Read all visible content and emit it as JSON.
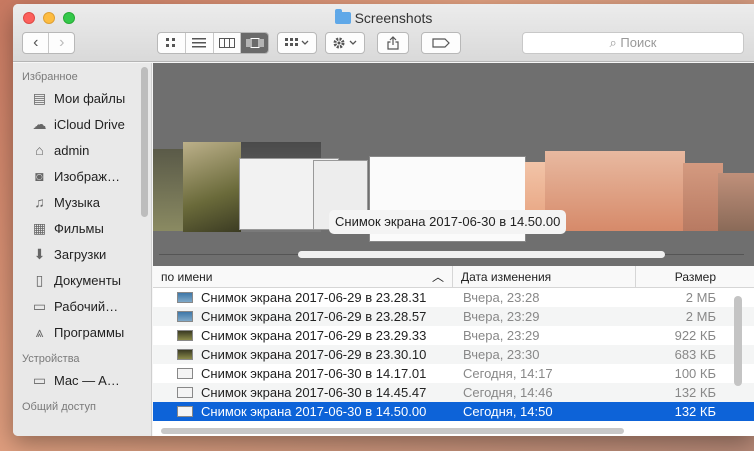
{
  "window": {
    "title": "Screenshots"
  },
  "toolbar": {
    "back_label": "‹",
    "forward_label": "›",
    "view_icons": [
      "icon-view-icon",
      "list-view-icon",
      "column-view-icon",
      "coverflow-view-icon"
    ],
    "search_placeholder": "⌕ Поиск"
  },
  "sidebar": {
    "sections": [
      {
        "title": "Избранное",
        "items": [
          {
            "label": "Мои файлы",
            "icon": "all-files-icon"
          },
          {
            "label": "iCloud Drive",
            "icon": "cloud-icon"
          },
          {
            "label": "admin",
            "icon": "home-icon"
          },
          {
            "label": "Изображ…",
            "icon": "camera-icon"
          },
          {
            "label": "Музыка",
            "icon": "music-icon"
          },
          {
            "label": "Фильмы",
            "icon": "film-icon"
          },
          {
            "label": "Загрузки",
            "icon": "download-icon"
          },
          {
            "label": "Документы",
            "icon": "document-icon"
          },
          {
            "label": "Рабочий…",
            "icon": "desktop-icon"
          },
          {
            "label": "Программы",
            "icon": "apps-icon"
          }
        ]
      },
      {
        "title": "Устройства",
        "items": [
          {
            "label": "Mac — A…",
            "icon": "computer-icon"
          }
        ]
      },
      {
        "title": "Общий доступ",
        "items": []
      }
    ]
  },
  "coverflow": {
    "selected_label": "Снимок экрана 2017-06-30 в 14.50.00"
  },
  "list": {
    "columns": {
      "name": "по имени",
      "date": "Дата изменения",
      "size": "Размер"
    },
    "rows": [
      {
        "name": "Снимок экрана 2017-06-29 в 23.28.31",
        "date": "Вчера, 23:28",
        "size": "2 МБ"
      },
      {
        "name": "Снимок экрана 2017-06-29 в 23.28.57",
        "date": "Вчера, 23:29",
        "size": "2 МБ"
      },
      {
        "name": "Снимок экрана 2017-06-29 в 23.29.33",
        "date": "Вчера, 23:29",
        "size": "922 КБ"
      },
      {
        "name": "Снимок экрана 2017-06-29 в 23.30.10",
        "date": "Вчера, 23:30",
        "size": "683 КБ"
      },
      {
        "name": "Снимок экрана 2017-06-30 в 14.17.01",
        "date": "Сегодня, 14:17",
        "size": "100 КБ"
      },
      {
        "name": "Снимок экрана 2017-06-30 в 14.45.47",
        "date": "Сегодня, 14:46",
        "size": "132 КБ"
      },
      {
        "name": "Снимок экрана 2017-06-30 в 14.50.00",
        "date": "Сегодня, 14:50",
        "size": "132 КБ",
        "selected": true
      }
    ]
  }
}
